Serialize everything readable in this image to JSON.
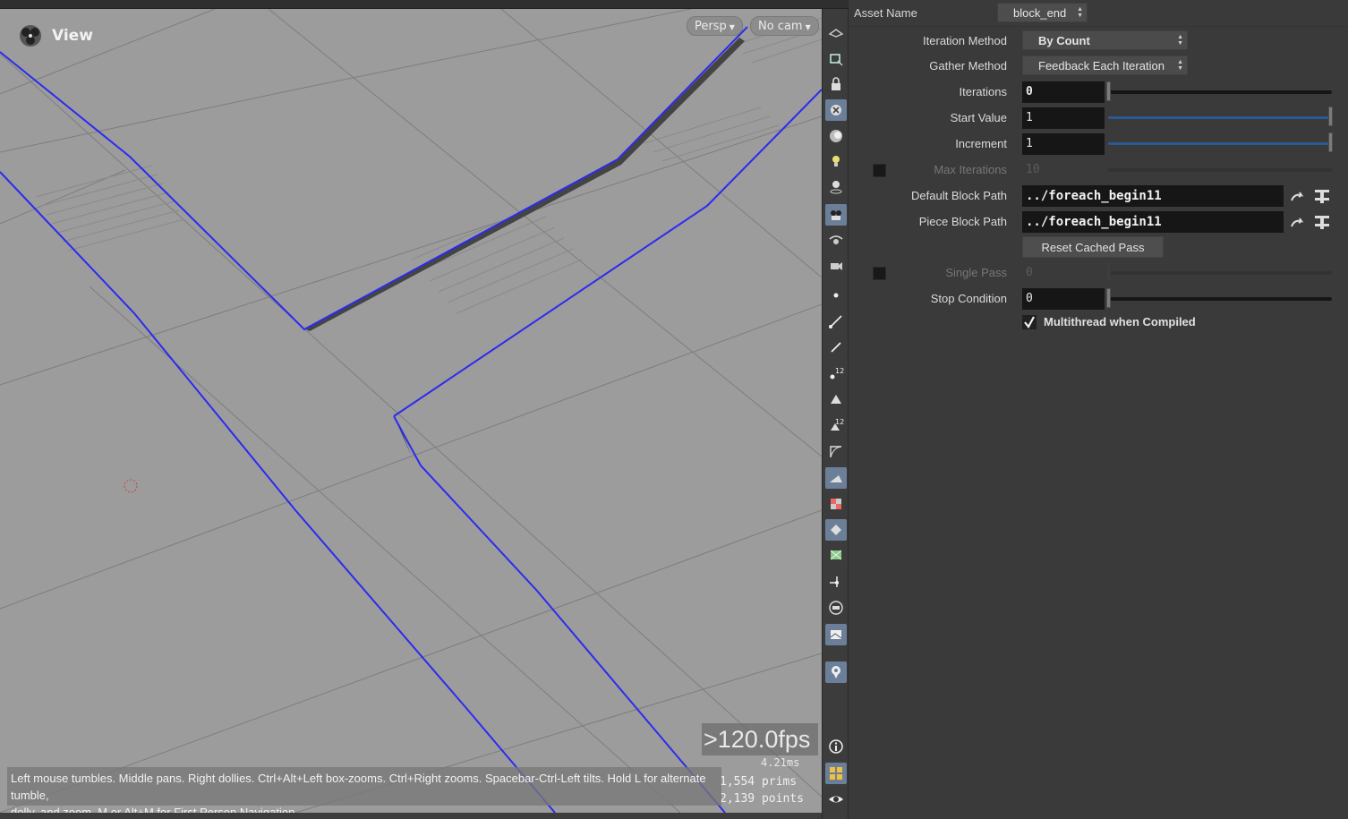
{
  "viewport": {
    "title": "View",
    "persp_label": "Persp",
    "cam_label": "No cam",
    "fps": ">120.0fps",
    "ms": "4.21ms",
    "prims": "1,554  prims",
    "points": "2,139 points",
    "hint_line1": "Left mouse tumbles. Middle pans. Right dollies. Ctrl+Alt+Left box-zooms. Ctrl+Right zooms. Spacebar-Ctrl-Left tilts. Hold L for alternate tumble,",
    "hint_line2": "dolly, and zoom. M or Alt+M for First Person Navigation.",
    "colors": {
      "background": "#9c9c9c",
      "curve": "#2b2bf0",
      "grid": "#7d7d7d"
    }
  },
  "toolbar": {
    "icons": [
      "select-icon",
      "view-icon",
      "lock-icon",
      "ghost-icon",
      "shading-icon",
      "light-icon",
      "lamp-icon",
      "camera-icon",
      "tumble-icon",
      "dolly-icon",
      "point-icon",
      "edge-icon",
      "pen-icon",
      "number-icon",
      "prim-icon",
      "prim-number-icon",
      "curve-icon",
      "normal-icon",
      "texture-icon",
      "snap-icon",
      "map-icon",
      "handle-icon",
      "display-icon",
      "background-icon",
      "marker-icon",
      "info-icon",
      "grid-icon",
      "eye-icon"
    ]
  },
  "params": {
    "asset_name_label": "Asset Name",
    "asset_name_value": "block_end",
    "iteration_method_label": "Iteration Method",
    "iteration_method_value": "By Count",
    "gather_method_label": "Gather Method",
    "gather_method_value": "Feedback Each Iteration",
    "iterations_label": "Iterations",
    "iterations_value": "0",
    "start_value_label": "Start Value",
    "start_value_value": "1",
    "increment_label": "Increment",
    "increment_value": "1",
    "max_iterations_label": "Max Iterations",
    "max_iterations_value": "10",
    "default_block_path_label": "Default Block Path",
    "default_block_path_value": "../foreach_begin11",
    "piece_block_path_label": "Piece Block Path",
    "piece_block_path_value": "../foreach_begin11",
    "reset_cached_pass_label": "Reset Cached Pass",
    "single_pass_label": "Single Pass",
    "single_pass_value": "0",
    "stop_condition_label": "Stop Condition",
    "stop_condition_value": "0",
    "multithread_label": "Multithread when Compiled",
    "multithread_checked": true
  }
}
